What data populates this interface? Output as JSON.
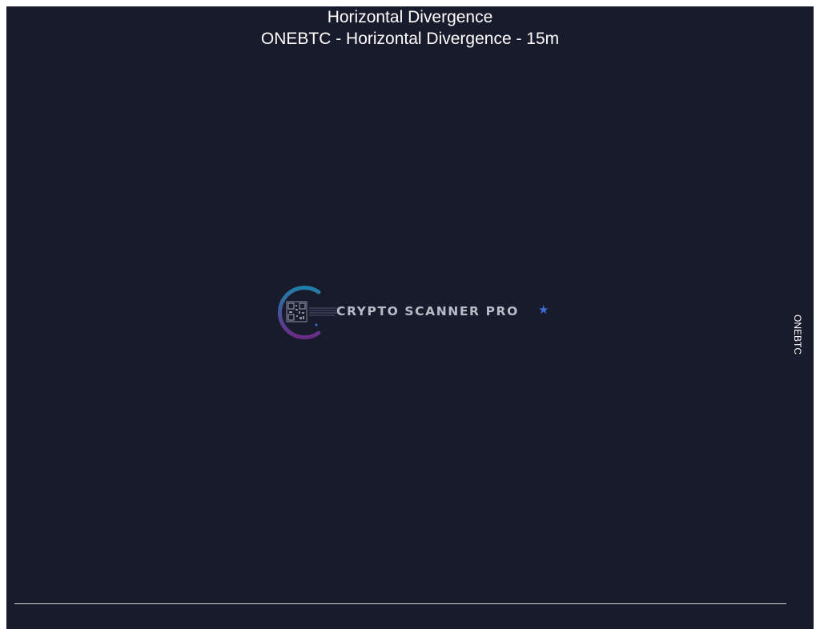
{
  "chart_data": {
    "type": "line",
    "title": "Horizontal Divergence",
    "subtitle": "ONEBTC - Horizontal Divergence - 15m",
    "series": [],
    "right_axis_label": "ONEBTC",
    "grid": false,
    "background_color": "#181b2b",
    "text_color": "#ffffff"
  },
  "watermark": {
    "text": "CRYPTO SCANNER PRO",
    "icon": "qr-code-icon",
    "star_icon": "star-icon"
  }
}
